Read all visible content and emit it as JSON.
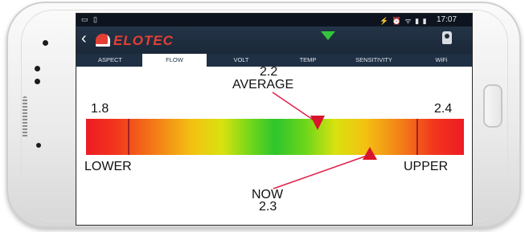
{
  "status_bar": {
    "left_icons": "▭ ▯",
    "right_icons": "⚡ ⏰ ᯤ ▮ ▮",
    "time": "17:07"
  },
  "app_bar": {
    "brand": "ELOTEC"
  },
  "tabs": [
    {
      "label": "ASPECT",
      "active": false
    },
    {
      "label": "FLOW",
      "active": true
    },
    {
      "label": "VOLT",
      "active": false
    },
    {
      "label": "TEMP",
      "active": false
    },
    {
      "label": "SENSITIVITY",
      "active": false
    },
    {
      "label": "WiFi",
      "active": false
    }
  ],
  "gauge": {
    "average_label": "AVERAGE",
    "average_value": "2.2",
    "lower_label": "LOWER",
    "lower_value": "1.8",
    "upper_label": "UPPER",
    "upper_value": "2.4",
    "now_label": "NOW",
    "now_value": "2.3",
    "colors": {
      "marker": "#d8152a",
      "pointer_line": "#e0204a"
    }
  }
}
